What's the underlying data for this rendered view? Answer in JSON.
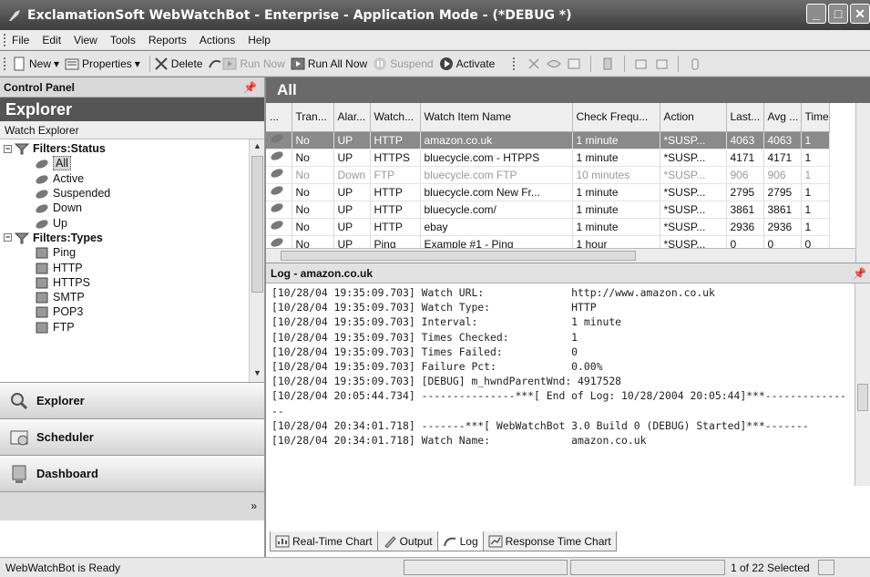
{
  "window": {
    "title": "ExclamationSoft WebWatchBot - Enterprise - Application Mode - (*DEBUG *)"
  },
  "menu": [
    "File",
    "Edit",
    "View",
    "Tools",
    "Reports",
    "Actions",
    "Help"
  ],
  "toolbar": {
    "new_label": "New",
    "properties_label": "Properties",
    "delete_label": "Delete",
    "run_now_label": "Run Now",
    "run_all_now_label": "Run All Now",
    "suspend_label": "Suspend",
    "activate_label": "Activate"
  },
  "left_panel": {
    "header": "Control Panel",
    "explorer_title": "Explorer",
    "subheader": "Watch Explorer",
    "tree": [
      {
        "label": "Filters:Status",
        "type": "group"
      },
      {
        "label": "All",
        "type": "status"
      },
      {
        "label": "Active",
        "type": "status"
      },
      {
        "label": "Suspended",
        "type": "status"
      },
      {
        "label": "Down",
        "type": "status"
      },
      {
        "label": "Up",
        "type": "status"
      },
      {
        "label": "Filters:Types",
        "type": "group"
      },
      {
        "label": "Ping",
        "type": "type"
      },
      {
        "label": "HTTP",
        "type": "type"
      },
      {
        "label": "HTTPS",
        "type": "type"
      },
      {
        "label": "SMTP",
        "type": "type"
      },
      {
        "label": "POP3",
        "type": "type"
      },
      {
        "label": "FTP",
        "type": "type"
      }
    ],
    "nav_buttons": [
      "Explorer",
      "Scheduler",
      "Dashboard"
    ]
  },
  "main": {
    "title": "All",
    "columns": [
      "...",
      "Tran...",
      "Alar...",
      "Watch...",
      "Watch Item Name",
      "Check Frequ...",
      "Action",
      "Last...",
      "Avg ...",
      "Time"
    ],
    "rows": [
      [
        "",
        "No",
        "UP",
        "HTTP",
        "amazon.co.uk",
        "1 minute",
        "*SUSP...",
        "4063",
        "4063",
        "1"
      ],
      [
        "",
        "No",
        "UP",
        "HTTPS",
        "bluecycle.com - HTPPS",
        "1 minute",
        "*SUSP...",
        "4171",
        "4171",
        "1"
      ],
      [
        "",
        "No",
        "Down",
        "FTP",
        "bluecycle.com FTP",
        "10 minutes",
        "*SUSP...",
        "906",
        "906",
        "1"
      ],
      [
        "",
        "No",
        "UP",
        "HTTP",
        "bluecycle.com New Fr...",
        "1 minute",
        "*SUSP...",
        "2795",
        "2795",
        "1"
      ],
      [
        "",
        "No",
        "UP",
        "HTTP",
        "bluecycle.com/",
        "1 minute",
        "*SUSP...",
        "3861",
        "3861",
        "1"
      ],
      [
        "",
        "No",
        "UP",
        "HTTP",
        "ebay",
        "1 minute",
        "*SUSP...",
        "2936",
        "2936",
        "1"
      ],
      [
        "",
        "No",
        "UP",
        "Ping",
        "Example #1 - Ping",
        "1 hour",
        "*SUSP...",
        "0",
        "0",
        "0"
      ]
    ]
  },
  "log": {
    "title": "Log - amazon.co.uk",
    "lines": [
      "[10/28/04 19:35:09.703] Watch URL:              http://www.amazon.co.uk",
      "[10/28/04 19:35:09.703] Watch Type:             HTTP",
      "[10/28/04 19:35:09.703] Interval:               1 minute",
      "[10/28/04 19:35:09.703] Times Checked:          1",
      "[10/28/04 19:35:09.703] Times Failed:           0",
      "[10/28/04 19:35:09.703] Failure Pct:            0.00%",
      "[10/28/04 19:35:09.703] [DEBUG] m_hwndParentWnd: 4917528",
      "[10/28/04 20:05:44.734] ---------------***[ End of Log: 10/28/2004 20:05:44]***---------------",
      "[10/28/04 20:34:01.718] -------***[ WebWatchBot 3.0 Build 0 (DEBUG) Started]***-------",
      "[10/28/04 20:34:01.718] Watch Name:             amazon.co.uk"
    ],
    "tabs": [
      "Real-Time Chart",
      "Output",
      "Log",
      "Response Time Chart"
    ]
  },
  "status": {
    "message": "WebWatchBot is Ready",
    "selection": "1 of 22 Selected"
  },
  "colors": {
    "title_bar": "#4a4a4a",
    "selected_row": "#8a8a8a",
    "header_dark": "#555555"
  }
}
